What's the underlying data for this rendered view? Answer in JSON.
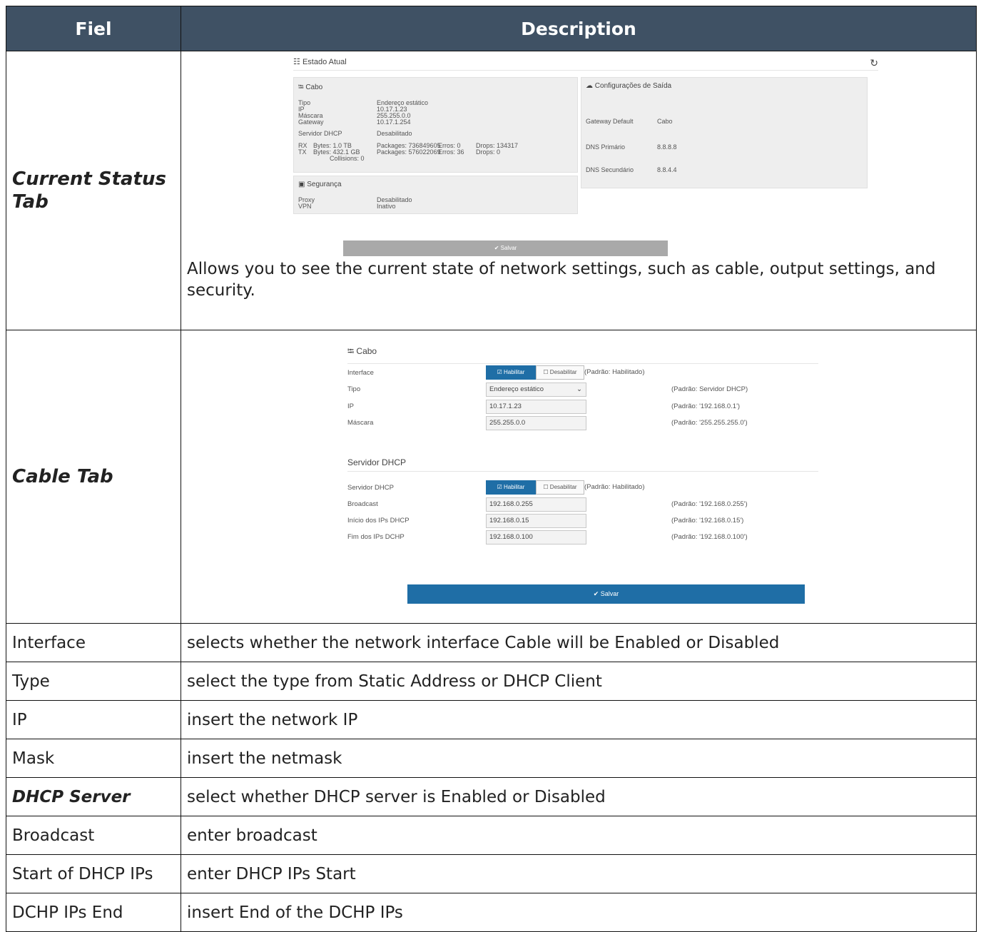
{
  "header": {
    "col1": "Fiel",
    "col2": "Description"
  },
  "current_status": {
    "label": "Current Status Tab",
    "description": "Allows you to see the current state of network settings, such as cable, output settings, and security.",
    "screenshot": {
      "title": "Estado Atual",
      "cabo_title": "Cabo",
      "cabo_rows": [
        {
          "k": "Tipo",
          "v": "Endereço estático"
        },
        {
          "k": "IP",
          "v": "10.17.1.23"
        },
        {
          "k": "Máscara",
          "v": "255.255.0.0"
        },
        {
          "k": "Gateway",
          "v": "10.17.1.254"
        },
        {
          "k": "Servidor DHCP",
          "v": "Desabilitado"
        }
      ],
      "rx": {
        "label": "RX",
        "bytes": "Bytes: 1.0 TB",
        "packages": "Packages: 736849605",
        "erros": "Erros: 0",
        "drops": "Drops: 134317"
      },
      "tx": {
        "label": "TX",
        "bytes": "Bytes: 432.1 GB",
        "packages": "Packages: 576022069",
        "erros": "Erros: 36",
        "drops": "Drops: 0",
        "collisions": "Collisions: 0"
      },
      "saida_title": "Configurações de Saída",
      "saida_rows": [
        {
          "k": "Gateway Default",
          "v": "Cabo"
        },
        {
          "k": "DNS Primário",
          "v": "8.8.8.8"
        },
        {
          "k": "DNS Secundário",
          "v": "8.8.4.4"
        }
      ],
      "seg_title": "Segurança",
      "seg_rows": [
        {
          "k": "Proxy",
          "v": "Desabilitado"
        },
        {
          "k": "VPN",
          "v": "Inativo"
        }
      ],
      "save": "Salvar"
    }
  },
  "cable": {
    "label": "Cable Tab",
    "screenshot": {
      "cabo_title": "Cabo",
      "interface_label": "Interface",
      "enable": "Habilitar",
      "disable": "Desabilitar",
      "interface_default": "(Padrão: Habilitado)",
      "tipo_label": "Tipo",
      "tipo_value": "Endereço estático",
      "tipo_hint": "(Padrão: Servidor DHCP)",
      "ip_label": "IP",
      "ip_value": "10.17.1.23",
      "ip_hint": "(Padrão: '192.168.0.1')",
      "mask_label": "Máscara",
      "mask_value": "255.255.0.0",
      "mask_hint": "(Padrão: '255.255.255.0')",
      "dhcp_title": "Servidor DHCP",
      "dhcp_label": "Servidor DHCP",
      "dhcp_default": "(Padrão: Habilitado)",
      "bc_label": "Broadcast",
      "bc_value": "192.168.0.255",
      "bc_hint": "(Padrão: '192.168.0.255')",
      "start_label": "Início dos IPs DHCP",
      "start_value": "192.168.0.15",
      "start_hint": "(Padrão: '192.168.0.15')",
      "end_label": "Fim dos IPs DCHP",
      "end_value": "192.168.0.100",
      "end_hint": "(Padrão: '192.168.0.100')",
      "save": "Salvar"
    }
  },
  "rows": [
    {
      "field": "Interface",
      "desc": "selects whether the network interface Cable will be Enabled or Disabled"
    },
    {
      "field": "Type",
      "desc": "select the type from Static Address or DHCP Client"
    },
    {
      "field": "IP",
      "desc": "insert the network IP"
    },
    {
      "field": "Mask",
      "desc": "insert the netmask"
    },
    {
      "field": "DHCP Server",
      "desc": "select whether DHCP server is Enabled or Disabled",
      "style": "bold-italic"
    },
    {
      "field": "Broadcast",
      "desc": "enter broadcast"
    },
    {
      "field": "Start of DHCP IPs",
      "desc": "enter DHCP IPs Start"
    },
    {
      "field": "DCHP IPs End",
      "desc": "insert End of the DCHP IPs"
    }
  ]
}
